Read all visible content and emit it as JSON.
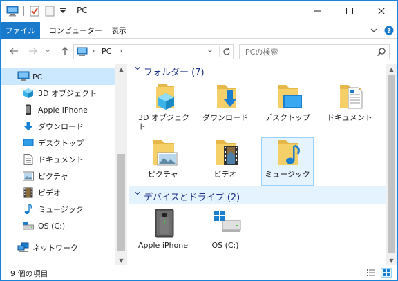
{
  "window": {
    "title": "PC"
  },
  "ribbon": {
    "tabs": [
      {
        "label": "ファイル",
        "active": true
      },
      {
        "label": "コンピューター",
        "active": false
      },
      {
        "label": "表示",
        "active": false
      }
    ]
  },
  "address": {
    "crumbs": [
      "PC"
    ]
  },
  "search": {
    "placeholder": "PCの検索"
  },
  "nav_pane": {
    "items": [
      {
        "label": "PC",
        "icon": "pc-icon",
        "selected": true
      },
      {
        "label": "3D オブジェクト",
        "icon": "3d-objects-icon"
      },
      {
        "label": "Apple iPhone",
        "icon": "iphone-icon"
      },
      {
        "label": "ダウンロード",
        "icon": "download-icon"
      },
      {
        "label": "デスクトップ",
        "icon": "desktop-icon"
      },
      {
        "label": "ドキュメント",
        "icon": "documents-icon"
      },
      {
        "label": "ピクチャ",
        "icon": "pictures-icon"
      },
      {
        "label": "ビデオ",
        "icon": "videos-icon"
      },
      {
        "label": "ミュージック",
        "icon": "music-icon"
      },
      {
        "label": "OS (C:)",
        "icon": "drive-icon"
      },
      {
        "label": "ネットワーク",
        "icon": "network-icon"
      }
    ]
  },
  "content": {
    "folders_group": {
      "title": "フォルダー (7)",
      "items": [
        {
          "label": "3D オブジェクト",
          "icon": "3d-objects-folder-icon"
        },
        {
          "label": "ダウンロード",
          "icon": "download-folder-icon"
        },
        {
          "label": "デスクトップ",
          "icon": "desktop-folder-icon"
        },
        {
          "label": "ドキュメント",
          "icon": "documents-folder-icon"
        },
        {
          "label": "ピクチャ",
          "icon": "pictures-folder-icon"
        },
        {
          "label": "ビデオ",
          "icon": "videos-folder-icon"
        },
        {
          "label": "ミュージック",
          "icon": "music-folder-icon",
          "selected": true
        }
      ]
    },
    "devices_group": {
      "title": "デバイスとドライブ (2)",
      "items": [
        {
          "label": "Apple iPhone",
          "icon": "iphone-device-icon"
        },
        {
          "label": "OS (C:)",
          "icon": "windows-drive-icon"
        }
      ]
    }
  },
  "status": {
    "item_count": "9 個の項目"
  },
  "colors": {
    "accent": "#1979ca",
    "selection": "#cce8ff",
    "group_title": "#1e3287"
  }
}
